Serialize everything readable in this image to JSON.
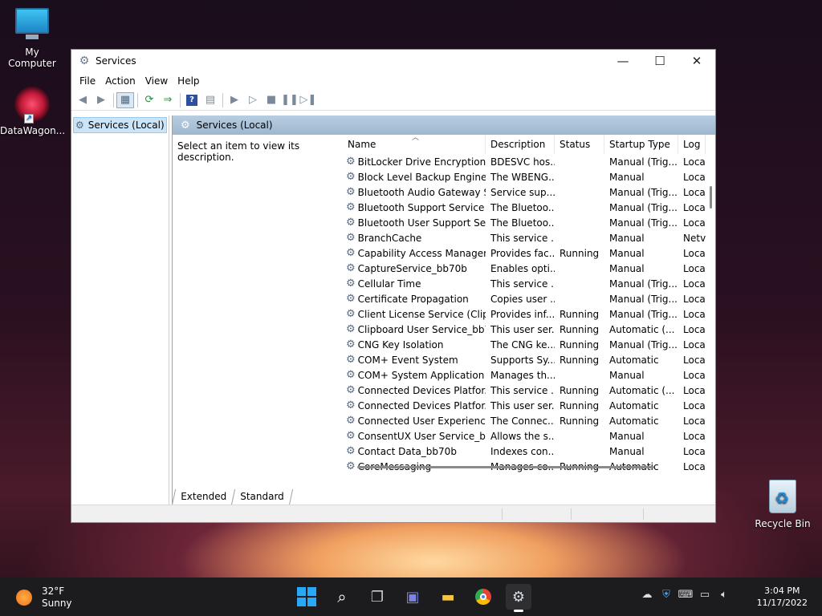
{
  "desktop": {
    "icons": [
      {
        "label": "My Computer"
      },
      {
        "label": "DataWagon..."
      },
      {
        "label": "Recycle Bin"
      }
    ]
  },
  "window": {
    "title": "Services",
    "menu": [
      "File",
      "Action",
      "View",
      "Help"
    ],
    "tree_item": "Services (Local)",
    "pane_header": "Services (Local)",
    "description_hint": "Select an item to view its description.",
    "columns": [
      "Name",
      "Description",
      "Status",
      "Startup Type",
      "Log"
    ],
    "rows": [
      {
        "name": "BitLocker Drive Encryption ...",
        "desc": "BDESVC hos...",
        "status": "",
        "startup": "Manual (Trig...",
        "log": "Loca"
      },
      {
        "name": "Block Level Backup Engine ...",
        "desc": "The WBENG...",
        "status": "",
        "startup": "Manual",
        "log": "Loca"
      },
      {
        "name": "Bluetooth Audio Gateway S...",
        "desc": "Service sup...",
        "status": "",
        "startup": "Manual (Trig...",
        "log": "Loca"
      },
      {
        "name": "Bluetooth Support Service",
        "desc": "The Bluetoo...",
        "status": "",
        "startup": "Manual (Trig...",
        "log": "Loca"
      },
      {
        "name": "Bluetooth User Support Ser...",
        "desc": "The Bluetoo...",
        "status": "",
        "startup": "Manual (Trig...",
        "log": "Loca"
      },
      {
        "name": "BranchCache",
        "desc": "This service ...",
        "status": "",
        "startup": "Manual",
        "log": "Netv"
      },
      {
        "name": "Capability Access Manager ...",
        "desc": "Provides fac...",
        "status": "Running",
        "startup": "Manual",
        "log": "Loca"
      },
      {
        "name": "CaptureService_bb70b",
        "desc": "Enables opti...",
        "status": "",
        "startup": "Manual",
        "log": "Loca"
      },
      {
        "name": "Cellular Time",
        "desc": "This service ...",
        "status": "",
        "startup": "Manual (Trig...",
        "log": "Loca"
      },
      {
        "name": "Certificate Propagation",
        "desc": "Copies user ...",
        "status": "",
        "startup": "Manual (Trig...",
        "log": "Loca"
      },
      {
        "name": "Client License Service (ClipS...",
        "desc": "Provides inf...",
        "status": "Running",
        "startup": "Manual (Trig...",
        "log": "Loca"
      },
      {
        "name": "Clipboard User Service_bb70b",
        "desc": "This user ser...",
        "status": "Running",
        "startup": "Automatic (...",
        "log": "Loca"
      },
      {
        "name": "CNG Key Isolation",
        "desc": "The CNG ke...",
        "status": "Running",
        "startup": "Manual (Trig...",
        "log": "Loca"
      },
      {
        "name": "COM+ Event System",
        "desc": "Supports Sy...",
        "status": "Running",
        "startup": "Automatic",
        "log": "Loca"
      },
      {
        "name": "COM+ System Application",
        "desc": "Manages th...",
        "status": "",
        "startup": "Manual",
        "log": "Loca"
      },
      {
        "name": "Connected Devices Platfor...",
        "desc": "This service ...",
        "status": "Running",
        "startup": "Automatic (...",
        "log": "Loca"
      },
      {
        "name": "Connected Devices Platfor...",
        "desc": "This user ser...",
        "status": "Running",
        "startup": "Automatic",
        "log": "Loca"
      },
      {
        "name": "Connected User Experience...",
        "desc": "The Connec...",
        "status": "Running",
        "startup": "Automatic",
        "log": "Loca"
      },
      {
        "name": "ConsentUX User Service_bb...",
        "desc": "Allows the s...",
        "status": "",
        "startup": "Manual",
        "log": "Loca"
      },
      {
        "name": "Contact Data_bb70b",
        "desc": "Indexes con...",
        "status": "",
        "startup": "Manual",
        "log": "Loca"
      },
      {
        "name": "CoreMessaging",
        "desc": "Manages co...",
        "status": "Running",
        "startup": "Automatic",
        "log": "Loca"
      }
    ],
    "tabs": [
      "Extended",
      "Standard"
    ]
  },
  "taskbar": {
    "weather_temp": "32°F",
    "weather_desc": "Sunny",
    "time": "3:04 PM",
    "date": "11/17/2022"
  }
}
